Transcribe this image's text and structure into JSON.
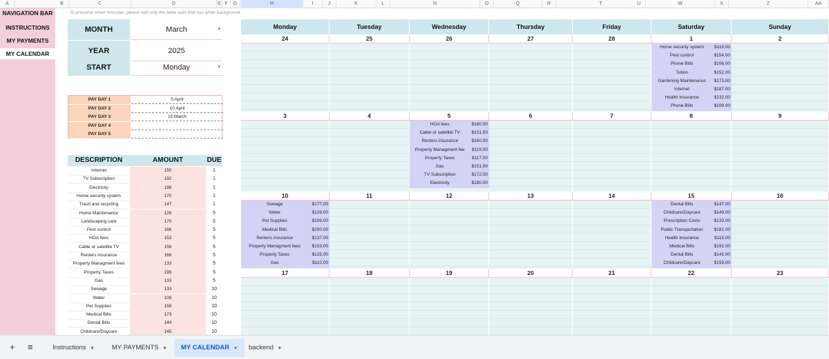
{
  "col_headers": [
    "A",
    "B",
    "C",
    "D",
    "E",
    "F",
    "G",
    "H",
    "I",
    "J",
    "K",
    "L",
    "N",
    "O",
    "Q",
    "R",
    "T",
    "U",
    "W",
    "X",
    "Z",
    "AA"
  ],
  "nav": {
    "title": "NAVIGATION BAR",
    "items": [
      "INSTRUCTIONS",
      "MY PAYMENTS",
      "MY CALENDAR"
    ]
  },
  "hint": "To preserve sheet formulas, please edit only the table cells that has white background",
  "setup": {
    "month_label": "MONTH",
    "month": "March",
    "year_label": "YEAR",
    "year": "2025",
    "start_label": "START",
    "start": "Monday"
  },
  "paydays": [
    {
      "label": "PAY DAY 1",
      "value": "5 April"
    },
    {
      "label": "PAY DAY 2",
      "value": "10 April"
    },
    {
      "label": "PAY DAY 3",
      "value": "15 March"
    },
    {
      "label": "PAY DAY 4",
      "value": ""
    },
    {
      "label": "PAY DAY 5",
      "value": ""
    }
  ],
  "bills": {
    "headers": [
      "DESCRIPTION",
      "AMOUNT",
      "DUE"
    ],
    "rows": [
      [
        "Internet",
        "150",
        "1"
      ],
      [
        "TV Subscription",
        "192",
        "1"
      ],
      [
        "Electricity",
        "198",
        "1"
      ],
      [
        "Home security system",
        "170",
        "1"
      ],
      [
        "Trash and recycling",
        "147",
        "1"
      ],
      [
        "Home Maintenance",
        "128",
        "5"
      ],
      [
        "Landscaping care",
        "170",
        "5"
      ],
      [
        "Pest control",
        "166",
        "5"
      ],
      [
        "HOA fees",
        "153",
        "5"
      ],
      [
        "Cable or satellite TV",
        "156",
        "5"
      ],
      [
        "Renters insurance",
        "166",
        "5"
      ],
      [
        "Property Managment fees",
        "133",
        "5"
      ],
      [
        "Property Taxes",
        "199",
        "5"
      ],
      [
        "Gas",
        "133",
        "5"
      ],
      [
        "Sewage",
        "133",
        "10"
      ],
      [
        "Water",
        "109",
        "10"
      ],
      [
        "Pet Supplies",
        "158",
        "10"
      ],
      [
        "Medical Bills",
        "173",
        "10"
      ],
      [
        "Dental Bills",
        "144",
        "10"
      ],
      [
        "Childcare/Daycare",
        "145",
        "10"
      ]
    ]
  },
  "calendar": {
    "days": [
      "Monday",
      "Tuesday",
      "Wednesday",
      "Thursday",
      "Friday",
      "Saturday",
      "Sunday"
    ],
    "weeks": [
      [
        "24",
        "25",
        "26",
        "27",
        "28",
        "1",
        "2"
      ],
      [
        "3",
        "4",
        "5",
        "6",
        "7",
        "8",
        "9"
      ],
      [
        "10",
        "11",
        "12",
        "13",
        "14",
        "15",
        "16"
      ],
      [
        "17",
        "18",
        "19",
        "20",
        "21",
        "22",
        "23"
      ]
    ],
    "events": [
      {
        "week": 0,
        "day": 5,
        "items": [
          [
            "Home security system",
            "$116.00"
          ],
          [
            "Pest control",
            "$154.00"
          ],
          [
            "Phone Bills",
            "$106.00"
          ],
          [
            "Tution",
            "$152.00"
          ],
          [
            "Gardening Maintenance",
            "$173.00"
          ],
          [
            "Internet",
            "$187.00"
          ],
          [
            "Health Insurance",
            "$132.00"
          ],
          [
            "Phone Bills",
            "$109.00"
          ]
        ]
      },
      {
        "week": 1,
        "day": 2,
        "items": [
          [
            "HOA fees",
            "$180.00"
          ],
          [
            "Cable or satellite TV",
            "$151.00"
          ],
          [
            "Renters insurance",
            "$160.00"
          ],
          [
            "Property Managment fee",
            "$119.00"
          ],
          [
            "Property Taxes",
            "$117.00"
          ],
          [
            "Gas",
            "$151.00"
          ],
          [
            "TV Subscription",
            "$172.00"
          ],
          [
            "Electricity",
            "$180.00"
          ]
        ]
      },
      {
        "week": 2,
        "day": 0,
        "items": [
          [
            "Sewage",
            "$177.00"
          ],
          [
            "Water",
            "$128.00"
          ],
          [
            "Pet Supplies",
            "$106.00"
          ],
          [
            "Medical Bills",
            "$200.00"
          ],
          [
            "Renters insurance",
            "$137.00"
          ],
          [
            "Property Managment fees",
            "$153.00"
          ],
          [
            "Property Taxes",
            "$125.00"
          ],
          [
            "Gas",
            "$110.00"
          ]
        ]
      },
      {
        "week": 2,
        "day": 5,
        "items": [
          [
            "Dental Bills",
            "$147.00"
          ],
          [
            "Childcare/Daycare",
            "$149.00"
          ],
          [
            "Prescription Costs",
            "$133.00"
          ],
          [
            "Public Transportation",
            "$181.00"
          ],
          [
            "Health Insurance",
            "$115.00"
          ],
          [
            "Medical Bills",
            "$191.00"
          ],
          [
            "Dental Bills",
            "$142.00"
          ],
          [
            "Childcare/Daycare",
            "$159.00"
          ]
        ]
      }
    ]
  },
  "tabs": {
    "add_icon": "+",
    "menu_icon": "≡",
    "items": [
      "Instructions",
      "MY PAYMENTS",
      "MY CALENDAR",
      "backend"
    ],
    "active": "MY CALENDAR",
    "dropdown_icon": "▼"
  }
}
